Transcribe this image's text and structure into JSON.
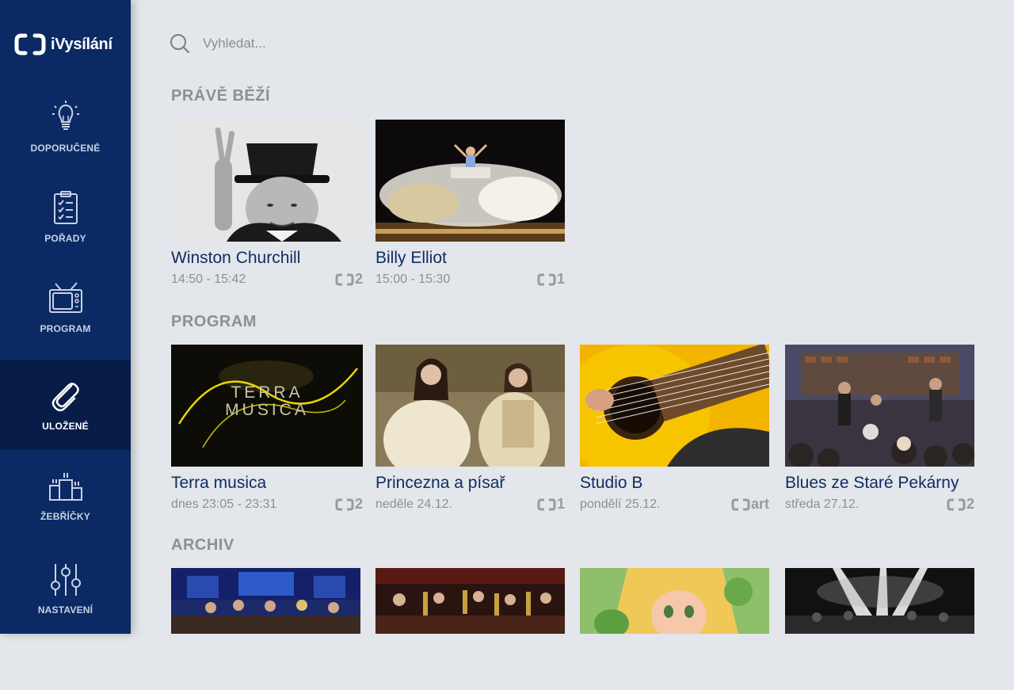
{
  "app": {
    "title": "iVysílání"
  },
  "nav": {
    "items": [
      {
        "label": "DOPORUČENÉ",
        "icon": "lightbulb-icon"
      },
      {
        "label": "POŘADY",
        "icon": "clipboard-icon"
      },
      {
        "label": "PROGRAM",
        "icon": "tv-icon"
      },
      {
        "label": "ULOŽENÉ",
        "icon": "paperclip-icon",
        "active": true
      },
      {
        "label": "ŽEBŘÍČKY",
        "icon": "podium-icon"
      },
      {
        "label": "NASTAVENÍ",
        "icon": "sliders-icon"
      }
    ]
  },
  "search": {
    "placeholder": "Vyhledat..."
  },
  "sections": {
    "now": {
      "title": "PRÁVĚ BĚŽÍ",
      "cards": [
        {
          "title": "Winston Churchill",
          "time": "14:50 - 15:42",
          "channel": "2"
        },
        {
          "title": "Billy Elliot",
          "time": "15:00 - 15:30",
          "channel": "1"
        }
      ]
    },
    "program": {
      "title": "PROGRAM",
      "cards": [
        {
          "title": "Terra musica",
          "time": "dnes 23:05 - 23:31",
          "channel": "2",
          "thumb_text": [
            "TERRA",
            "MUSICA"
          ]
        },
        {
          "title": "Princezna a písař",
          "time": "neděle 24.12.",
          "channel": "1"
        },
        {
          "title": "Studio B",
          "time": "pondělí 25.12.",
          "channel": "art"
        },
        {
          "title": "Blues ze Staré Pekárny",
          "time": "středa 27.12.",
          "channel": "2"
        }
      ]
    },
    "archive": {
      "title": "ARCHIV"
    }
  },
  "colors": {
    "sidebar": "#0b2a63",
    "sidebar_active": "#071d48",
    "background": "#e3e6ea",
    "title": "#0f2d63"
  }
}
